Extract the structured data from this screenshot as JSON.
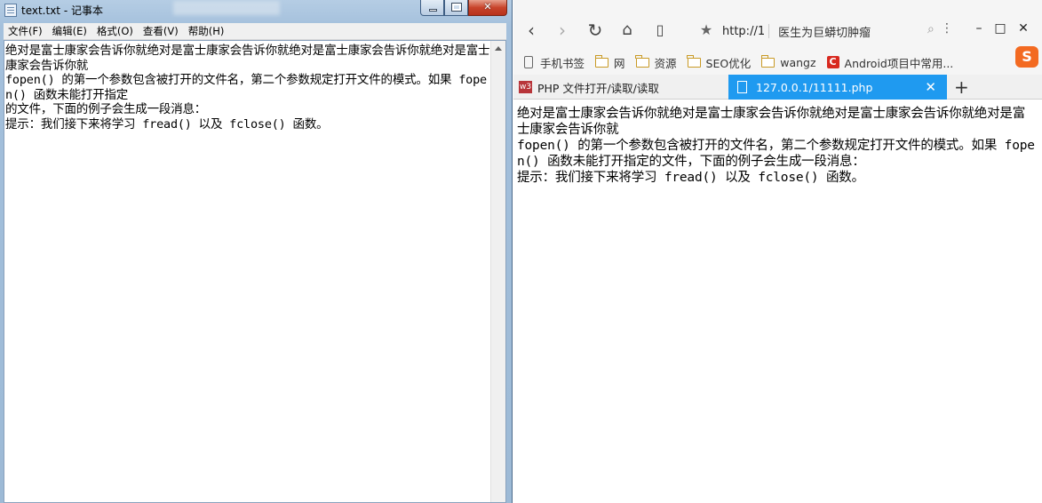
{
  "notepad": {
    "title": "text.txt - 记事本",
    "menu": [
      "文件(F)",
      "编辑(E)",
      "格式(O)",
      "查看(V)",
      "帮助(H)"
    ],
    "content_lines": [
      "绝对是富士康家会告诉你就绝对是富士康家会告诉你就绝对是富士康家会告诉你就绝对是富士康家会告诉你就",
      "fopen() 的第一个参数包含被打开的文件名，第二个参数规定打开文件的模式。如果 fopen() 函数未能打开指定",
      "的文件，下面的例子会生成一段消息：",
      "提示：我们接下来将学习 fread() 以及 fclose() 函数。"
    ]
  },
  "browser": {
    "address_text": "http://1",
    "address_hint": "医生为巨蟒切肿瘤",
    "bookmarks": [
      "手机书签",
      "网",
      "资源",
      "SEO优化",
      "wangz",
      "Android项目中常用..."
    ],
    "tabs": [
      {
        "label": "PHP 文件打开/读取/读取",
        "active": false
      },
      {
        "label": "127.0.0.1/11111.php",
        "active": true
      }
    ],
    "page_lines": [
      "绝对是富士康家会告诉你就绝对是富士康家会告诉你就绝对是富士康家会告诉你就绝对是富士康家会告诉你就",
      "fopen() 的第一个参数包含被打开的文件名，第二个参数规定打开文件的模式。如果 fopen() 函数未能打开指定的文件，下面的例子会生成一段消息：",
      "提示：我们接下来将学习 fread() 以及 fclose() 函数。"
    ]
  },
  "colors": {
    "active_tab": "#1f9af0",
    "close_button": "#c8442b",
    "notepad_frame": "#a4c0dc"
  }
}
